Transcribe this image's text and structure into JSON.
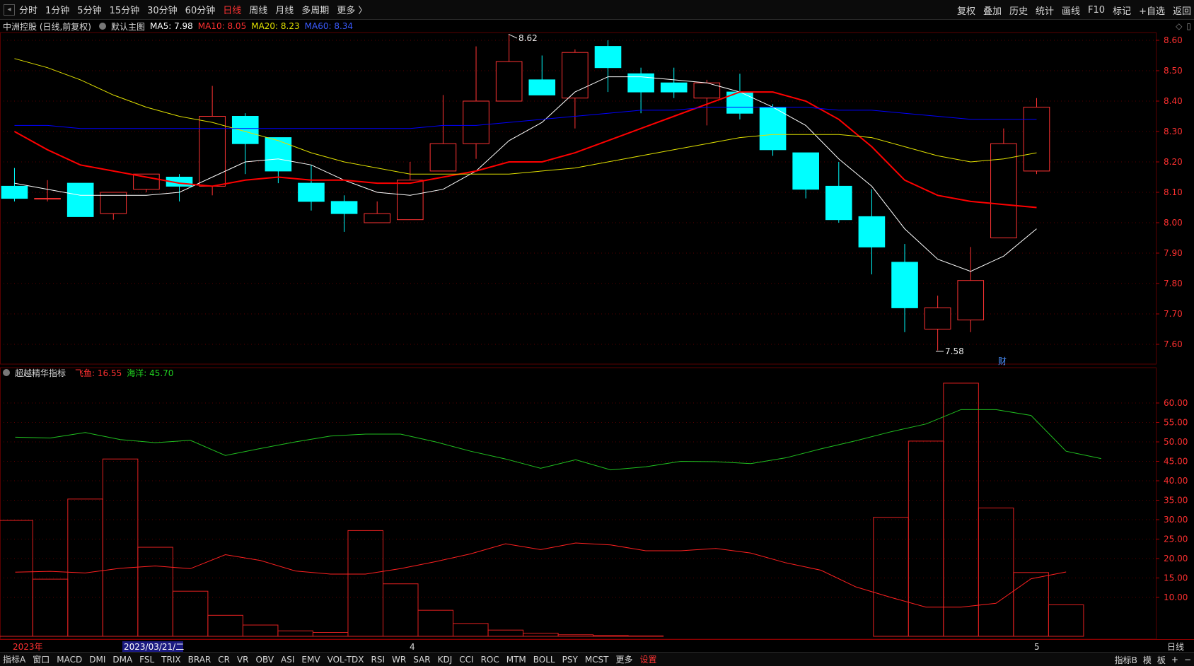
{
  "toolbar": {
    "periods": [
      "分时",
      "1分钟",
      "5分钟",
      "15分钟",
      "30分钟",
      "60分钟",
      "日线",
      "周线",
      "月线",
      "多周期",
      "更多 〉"
    ],
    "active_index": 6,
    "right_buttons": [
      "复权",
      "叠加",
      "历史",
      "统计",
      "画线",
      "F10",
      "标记",
      "+自选",
      "返回"
    ]
  },
  "main_info": {
    "stock": "中洲控股 (日线,前复权)",
    "template": "默认主图",
    "ma5": "MA5: 7.98",
    "ma10": "MA10: 8.05",
    "ma20": "MA20: 8.23",
    "ma60": "MA60: 8.34"
  },
  "sub_info": {
    "name": "超越精华指标",
    "feiyu": "飞鱼: 16.55",
    "haiyang": "海洋: 45.70"
  },
  "dates": {
    "start": "2023年",
    "cursor": "2023/03/21/二",
    "month4": "4",
    "month5": "5",
    "period_label": "日线"
  },
  "markers": {
    "high": "8.62",
    "low": "7.58",
    "finance": "财"
  },
  "bottom_tabs": [
    "指标A",
    "窗口",
    "MACD",
    "DMI",
    "DMA",
    "FSL",
    "TRIX",
    "BRAR",
    "CR",
    "VR",
    "OBV",
    "ASI",
    "EMV",
    "VOL-TDX",
    "RSI",
    "WR",
    "SAR",
    "KDJ",
    "CCI",
    "ROC",
    "MTM",
    "BOLL",
    "PSY",
    "MCST",
    "更多",
    "设置"
  ],
  "bottom_right": [
    "指标B",
    "模",
    "板",
    "+",
    "−"
  ],
  "colors": {
    "up": "#ff3333",
    "down": "#00ffff",
    "ma5": "#ffffff",
    "ma10": "#ff0000",
    "ma20": "#e0e000",
    "ma60": "#0000ff",
    "feiyu": "#ff2020",
    "haiyang": "#20c020",
    "grid": "#5a0000"
  },
  "chart_data": [
    {
      "type": "candlestick",
      "title": "中洲控股 (日线,前复权)",
      "ylim": [
        7.55,
        8.65
      ],
      "yticks": [
        "8.60",
        "8.50",
        "8.40",
        "8.30",
        "8.20",
        "8.10",
        "8.00",
        "7.90",
        "7.80",
        "7.70",
        "7.60"
      ],
      "candles": [
        {
          "o": 8.12,
          "c": 8.08,
          "h": 8.18,
          "l": 8.07
        },
        {
          "o": 8.08,
          "c": 8.08,
          "h": 8.14,
          "l": 8.07
        },
        {
          "o": 8.13,
          "c": 8.02,
          "h": 8.13,
          "l": 8.02
        },
        {
          "o": 8.03,
          "c": 8.1,
          "h": 8.1,
          "l": 8.01
        },
        {
          "o": 8.11,
          "c": 8.16,
          "h": 8.16,
          "l": 8.1
        },
        {
          "o": 8.15,
          "c": 8.12,
          "h": 8.16,
          "l": 8.07
        },
        {
          "o": 8.12,
          "c": 8.35,
          "h": 8.45,
          "l": 8.09
        },
        {
          "o": 8.35,
          "c": 8.26,
          "h": 8.36,
          "l": 8.16
        },
        {
          "o": 8.28,
          "c": 8.17,
          "h": 8.28,
          "l": 8.13
        },
        {
          "o": 8.13,
          "c": 8.07,
          "h": 8.19,
          "l": 8.04
        },
        {
          "o": 8.07,
          "c": 8.03,
          "h": 8.09,
          "l": 7.97
        },
        {
          "o": 8.0,
          "c": 8.03,
          "h": 8.07,
          "l": 8.0
        },
        {
          "o": 8.01,
          "c": 8.14,
          "h": 8.2,
          "l": 8.01
        },
        {
          "o": 8.17,
          "c": 8.26,
          "h": 8.42,
          "l": 8.17
        },
        {
          "o": 8.26,
          "c": 8.4,
          "h": 8.58,
          "l": 8.21
        },
        {
          "o": 8.4,
          "c": 8.53,
          "h": 8.62,
          "l": 8.4
        },
        {
          "o": 8.47,
          "c": 8.42,
          "h": 8.55,
          "l": 8.42
        },
        {
          "o": 8.41,
          "c": 8.56,
          "h": 8.57,
          "l": 8.31
        },
        {
          "o": 8.58,
          "c": 8.51,
          "h": 8.6,
          "l": 8.43
        },
        {
          "o": 8.49,
          "c": 8.43,
          "h": 8.51,
          "l": 8.36
        },
        {
          "o": 8.46,
          "c": 8.43,
          "h": 8.51,
          "l": 8.41
        },
        {
          "o": 8.41,
          "c": 8.46,
          "h": 8.47,
          "l": 8.32
        },
        {
          "o": 8.43,
          "c": 8.36,
          "h": 8.49,
          "l": 8.34
        },
        {
          "o": 8.38,
          "c": 8.24,
          "h": 8.39,
          "l": 8.22
        },
        {
          "o": 8.23,
          "c": 8.11,
          "h": 8.23,
          "l": 8.08
        },
        {
          "o": 8.12,
          "c": 8.01,
          "h": 8.2,
          "l": 8.0
        },
        {
          "o": 8.02,
          "c": 7.92,
          "h": 8.11,
          "l": 7.83
        },
        {
          "o": 7.87,
          "c": 7.72,
          "h": 7.93,
          "l": 7.64
        },
        {
          "o": 7.65,
          "c": 7.72,
          "h": 7.76,
          "l": 7.58
        },
        {
          "o": 7.68,
          "c": 7.81,
          "h": 7.92,
          "l": 7.64
        },
        {
          "o": 7.95,
          "c": 8.26,
          "h": 8.31,
          "l": 7.95
        },
        {
          "o": 8.17,
          "c": 8.38,
          "h": 8.41,
          "l": 8.16
        }
      ],
      "series": [
        {
          "name": "MA5",
          "values": [
            8.13,
            8.11,
            8.09,
            8.09,
            8.09,
            8.1,
            8.15,
            8.2,
            8.21,
            8.19,
            8.14,
            8.1,
            8.09,
            8.11,
            8.17,
            8.27,
            8.33,
            8.43,
            8.48,
            8.48,
            8.47,
            8.46,
            8.43,
            8.38,
            8.32,
            8.21,
            8.12,
            7.98,
            7.88,
            7.84,
            7.89,
            7.98
          ]
        },
        {
          "name": "MA10",
          "values": [
            8.3,
            8.24,
            8.19,
            8.17,
            8.15,
            8.13,
            8.12,
            8.14,
            8.15,
            8.14,
            8.14,
            8.13,
            8.13,
            8.15,
            8.17,
            8.2,
            8.2,
            8.23,
            8.27,
            8.31,
            8.35,
            8.39,
            8.43,
            8.43,
            8.4,
            8.34,
            8.25,
            8.14,
            8.09,
            8.07,
            8.06,
            8.05
          ]
        },
        {
          "name": "MA20",
          "values": [
            8.54,
            8.51,
            8.47,
            8.42,
            8.38,
            8.35,
            8.33,
            8.3,
            8.27,
            8.23,
            8.2,
            8.18,
            8.16,
            8.16,
            8.16,
            8.16,
            8.17,
            8.18,
            8.2,
            8.22,
            8.24,
            8.26,
            8.28,
            8.29,
            8.29,
            8.29,
            8.28,
            8.25,
            8.22,
            8.2,
            8.21,
            8.23
          ]
        },
        {
          "name": "MA60",
          "values": [
            8.32,
            8.32,
            8.31,
            8.31,
            8.31,
            8.31,
            8.31,
            8.31,
            8.31,
            8.31,
            8.31,
            8.31,
            8.31,
            8.32,
            8.32,
            8.33,
            8.34,
            8.35,
            8.36,
            8.37,
            8.37,
            8.38,
            8.38,
            8.38,
            8.38,
            8.37,
            8.37,
            8.36,
            8.35,
            8.34,
            8.34,
            8.34
          ]
        }
      ]
    },
    {
      "type": "bar+line",
      "title": "超越精华指标",
      "ylim": [
        0,
        65
      ],
      "yticks": [
        "60.00",
        "55.00",
        "50.00",
        "45.00",
        "40.00",
        "35.00",
        "30.00",
        "25.00",
        "20.00",
        "15.00",
        "10.00"
      ],
      "bars": [
        29.8,
        14.7,
        35.3,
        45.6,
        22.9,
        11.6,
        5.4,
        2.9,
        1.4,
        1.0,
        27.2,
        13.5,
        6.7,
        3.3,
        1.6,
        0.8,
        0.4,
        0.2,
        0.1,
        0,
        0,
        0,
        0,
        0,
        0,
        30.6,
        50.2,
        65.1,
        33.0,
        16.4,
        8.1
      ],
      "series": [
        {
          "name": "飞鱼",
          "values": [
            16.5,
            16.7,
            16.3,
            17.5,
            18.1,
            17.4,
            21.0,
            19.5,
            16.8,
            16.0,
            16.0,
            17.4,
            19.2,
            21.2,
            23.8,
            22.3,
            24.0,
            23.5,
            22.0,
            22.0,
            22.6,
            21.4,
            18.9,
            17.0,
            12.7,
            10.0,
            7.5,
            7.5,
            8.5,
            14.8,
            16.55
          ]
        },
        {
          "name": "海洋",
          "values": [
            51.2,
            51.0,
            52.4,
            50.6,
            49.8,
            50.4,
            46.5,
            48.3,
            50.0,
            51.5,
            52.0,
            52.0,
            50.0,
            47.6,
            45.6,
            43.2,
            45.4,
            42.8,
            43.6,
            45.0,
            44.9,
            44.4,
            45.9,
            48.2,
            50.3,
            52.6,
            54.6,
            58.3,
            58.3,
            56.8,
            47.6,
            45.7
          ]
        }
      ]
    }
  ]
}
